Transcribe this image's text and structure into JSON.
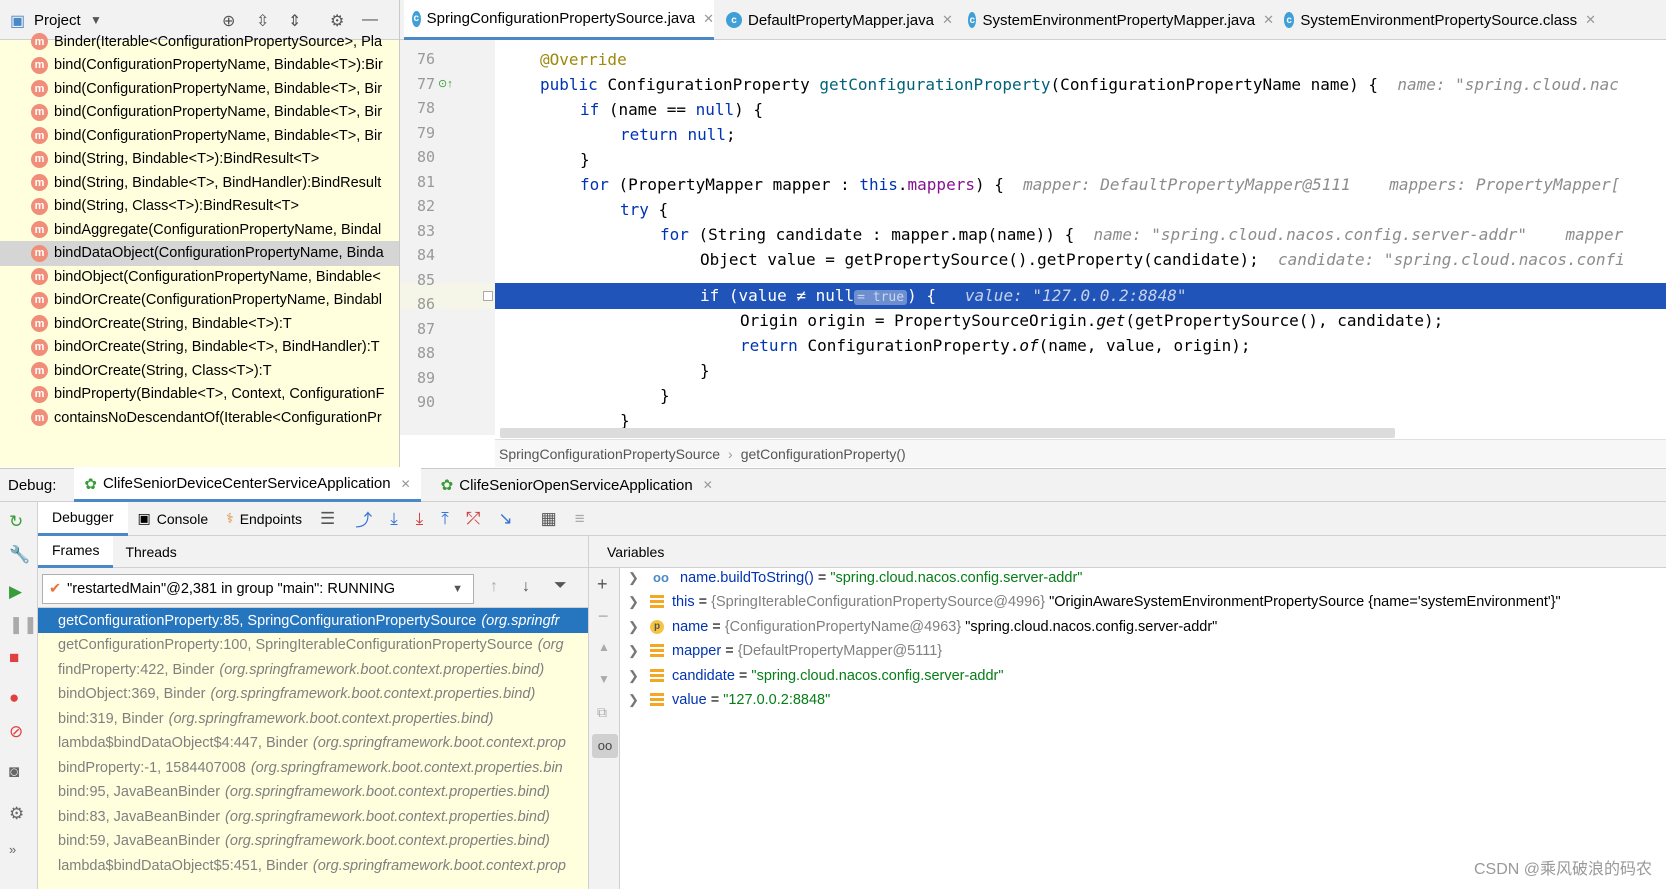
{
  "project": {
    "title": "Project",
    "methods": [
      {
        "text": "Binder(Iterable<ConfigurationPropertySource>, Pla"
      },
      {
        "text": "bind(ConfigurationPropertyName, Bindable<T>):Bir"
      },
      {
        "text": "bind(ConfigurationPropertyName, Bindable<T>, Bir"
      },
      {
        "text": "bind(ConfigurationPropertyName, Bindable<T>, Bir"
      },
      {
        "text": "bind(ConfigurationPropertyName, Bindable<T>, Bir"
      },
      {
        "text": "bind(String, Bindable<T>):BindResult<T>"
      },
      {
        "text": "bind(String, Bindable<T>, BindHandler):BindResult"
      },
      {
        "text": "bind(String, Class<T>):BindResult<T>"
      },
      {
        "text": "bindAggregate(ConfigurationPropertyName, Bindal"
      },
      {
        "text": "bindDataObject(ConfigurationPropertyName, Binda",
        "selected": true
      },
      {
        "text": "bindObject(ConfigurationPropertyName, Bindable<"
      },
      {
        "text": "bindOrCreate(ConfigurationPropertyName, Bindabl"
      },
      {
        "text": "bindOrCreate(String, Bindable<T>):T"
      },
      {
        "text": "bindOrCreate(String, Bindable<T>, BindHandler):T"
      },
      {
        "text": "bindOrCreate(String, Class<T>):T"
      },
      {
        "text": "bindProperty(Bindable<T>, Context, ConfigurationF"
      },
      {
        "text": "containsNoDescendantOf(Iterable<ConfigurationPr"
      }
    ]
  },
  "tabs": [
    {
      "label": "SpringConfigurationPropertySource.java",
      "active": true
    },
    {
      "label": "DefaultPropertyMapper.java"
    },
    {
      "label": "SystemEnvironmentPropertyMapper.java"
    },
    {
      "label": "SystemEnvironmentPropertySource.class"
    }
  ],
  "editor": {
    "line_numbers": [
      "76",
      "77",
      "78",
      "79",
      "80",
      "81",
      "82",
      "83",
      "84",
      "85",
      "86",
      "87",
      "88",
      "89",
      "90"
    ],
    "lines": {
      "l76": "@Override",
      "l77_a": "public ",
      "l77_b": "ConfigurationProperty ",
      "l77_c": "getConfigurationProperty",
      "l77_d": "(ConfigurationPropertyName name) {",
      "l77_hint": "name: \"spring.cloud.nac",
      "l78_a": "if ",
      "l78_b": "(name == ",
      "l78_c": "null",
      "l78_d": ") {",
      "l79_a": "return ",
      "l79_b": "null",
      "l79_c": ";",
      "l80": "}",
      "l81_a": "for ",
      "l81_b": "(PropertyMapper mapper : ",
      "l81_c": "this",
      "l81_d": ".",
      "l81_e": "mappers",
      "l81_f": ") {",
      "l81_hint": "mapper: DefaultPropertyMapper@5111    mappers: PropertyMapper[",
      "l82_a": "try ",
      "l82_b": "{",
      "l83_a": "for ",
      "l83_b": "(String candidate : mapper.map(name)) {",
      "l83_hint": "name: \"spring.cloud.nacos.config.server-addr\"    mapper",
      "l84_a": "Object value = getPropertySource().getProperty(candidate);",
      "l84_hint": "candidate: \"spring.cloud.nacos.confi",
      "l85_a": "if (value ≠ null",
      "l85_b": "= true",
      "l85_c": ") {",
      "l85_hint": "value: \"127.0.0.2:8848\"",
      "l86_a": "Origin origin = PropertySourceOrigin.",
      "l86_b": "get",
      "l86_c": "(getPropertySource(), candidate);",
      "l87_a": "return ",
      "l87_b": "ConfigurationProperty.",
      "l87_c": "of",
      "l87_d": "(name, value, origin);",
      "l88": "}",
      "l89": "}",
      "l90": "}"
    },
    "breadcrumb": [
      "SpringConfigurationPropertySource",
      "getConfigurationProperty()"
    ]
  },
  "debug": {
    "label": "Debug:",
    "sessions": [
      "ClifeSeniorDeviceCenterServiceApplication",
      "ClifeSeniorOpenServiceApplication"
    ],
    "toolbar": {
      "debugger": "Debugger",
      "console": "Console",
      "endpoints": "Endpoints"
    },
    "frames_tab": "Frames",
    "threads_tab": "Threads",
    "thread": "\"restartedMain\"@2,381 in group \"main\": RUNNING",
    "frames": [
      {
        "method": "getConfigurationProperty:85, SpringConfigurationPropertySource",
        "pkg": "(org.springfr",
        "selected": true
      },
      {
        "method": "getConfigurationProperty:100, SpringIterableConfigurationPropertySource",
        "pkg": "(org"
      },
      {
        "method": "findProperty:422, Binder",
        "pkg": "(org.springframework.boot.context.properties.bind)"
      },
      {
        "method": "bindObject:369, Binder",
        "pkg": "(org.springframework.boot.context.properties.bind)"
      },
      {
        "method": "bind:319, Binder",
        "pkg": "(org.springframework.boot.context.properties.bind)"
      },
      {
        "method": "lambda$bindDataObject$4:447, Binder",
        "pkg": "(org.springframework.boot.context.prop"
      },
      {
        "method": "bindProperty:-1, 1584407008",
        "pkg": "(org.springframework.boot.context.properties.bin"
      },
      {
        "method": "bind:95, JavaBeanBinder",
        "pkg": "(org.springframework.boot.context.properties.bind)"
      },
      {
        "method": "bind:83, JavaBeanBinder",
        "pkg": "(org.springframework.boot.context.properties.bind)"
      },
      {
        "method": "bind:59, JavaBeanBinder",
        "pkg": "(org.springframework.boot.context.properties.bind)"
      },
      {
        "method": "lambda$bindDataObject$5:451, Binder",
        "pkg": "(org.springframework.boot.context.prop"
      }
    ],
    "variables_title": "Variables",
    "variables": [
      {
        "icon": "watch",
        "name": "name.buildToString()",
        "eq": " = ",
        "ref": "",
        "value": "\"spring.cloud.nacos.config.server-addr\"",
        "vclass": "vstr"
      },
      {
        "icon": "field",
        "name": "this",
        "eq": " = ",
        "ref": "{SpringIterableConfigurationPropertySource@4996} ",
        "value": "\"OriginAwareSystemEnvironmentPropertySource {name='systemEnvironment'}\"",
        "vclass": "plain"
      },
      {
        "icon": "param",
        "name": "name",
        "eq": " = ",
        "ref": "{ConfigurationPropertyName@4963} ",
        "value": "\"spring.cloud.nacos.config.server-addr\"",
        "vclass": "plain"
      },
      {
        "icon": "field",
        "name": "mapper",
        "eq": " = ",
        "ref": "{DefaultPropertyMapper@5111}",
        "value": "",
        "vclass": "plain"
      },
      {
        "icon": "field",
        "name": "candidate",
        "eq": " = ",
        "ref": "",
        "value": "\"spring.cloud.nacos.config.server-addr\"",
        "vclass": "vstr"
      },
      {
        "icon": "field",
        "name": "value",
        "eq": " = ",
        "ref": "",
        "value": "\"127.0.0.2:8848\"",
        "vclass": "vstr"
      }
    ]
  },
  "watermark": "CSDN @乘风破浪的码农"
}
